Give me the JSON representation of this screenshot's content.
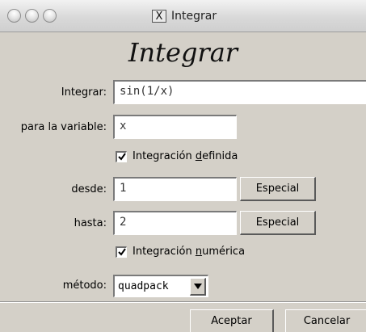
{
  "window": {
    "title": "Integrar",
    "title_icon_glyph": "X",
    "heading": "Integrar"
  },
  "form": {
    "integrar_label": "Integrar:",
    "integrar_value": "sin(1/x)",
    "variable_label": "para la variable:",
    "variable_value": "x",
    "definida": {
      "checked": true,
      "label_pre": "Integración ",
      "label_mnemonic": "d",
      "label_post": "efinida"
    },
    "desde_label": "desde:",
    "desde_value": "1",
    "hasta_label": "hasta:",
    "hasta_value": "2",
    "especial_label": "Especial",
    "numerica": {
      "checked": true,
      "label_pre": "Integración ",
      "label_mnemonic": "n",
      "label_post": "umérica"
    },
    "metodo_label": "método:",
    "metodo_value": "quadpack"
  },
  "buttons": {
    "accept": "Aceptar",
    "cancel": "Cancelar"
  }
}
